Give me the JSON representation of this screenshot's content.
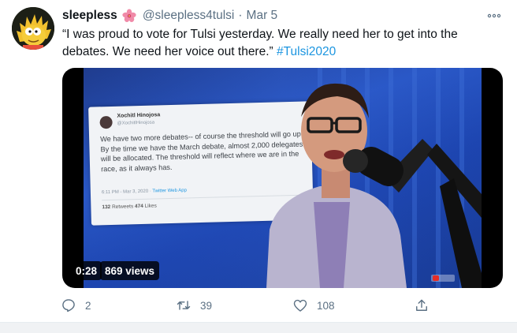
{
  "tweet": {
    "display_name": "sleepless",
    "handle": "@sleepless4tulsi",
    "separator": "·",
    "date": "Mar 5",
    "text": "“I was proud to vote for Tulsi yesterday. We really need her to get into the debates. We need her voice out there.” ",
    "hashtag": "#Tulsi2020",
    "more_icon": "more-horizontal-icon",
    "name_emoji": "hibiscus-icon"
  },
  "media": {
    "type": "video",
    "duration": "0:28",
    "views": "869 views",
    "embedded_tweet": {
      "name": "Xochitl Hinojosa",
      "handle": "@XochitlHinojosa",
      "body": "We have two more debates-- of course the threshold will go up. By the time we have the March debate, almost 2,000 delegates will be allocated. The threshold will reflect where we are in the race, as it always has.",
      "meta_time": "6:11 PM - Mar 3, 2020 · ",
      "meta_app": "Twitter Web App",
      "retweets_count": "132",
      "retweets_label": " Retweets   ",
      "likes_count": "474",
      "likes_label": " Likes"
    }
  },
  "actions": {
    "reply_count": "2",
    "retweet_count": "39",
    "like_count": "108",
    "colors": {
      "muted": "#5b7083",
      "link": "#1b95e0"
    }
  }
}
